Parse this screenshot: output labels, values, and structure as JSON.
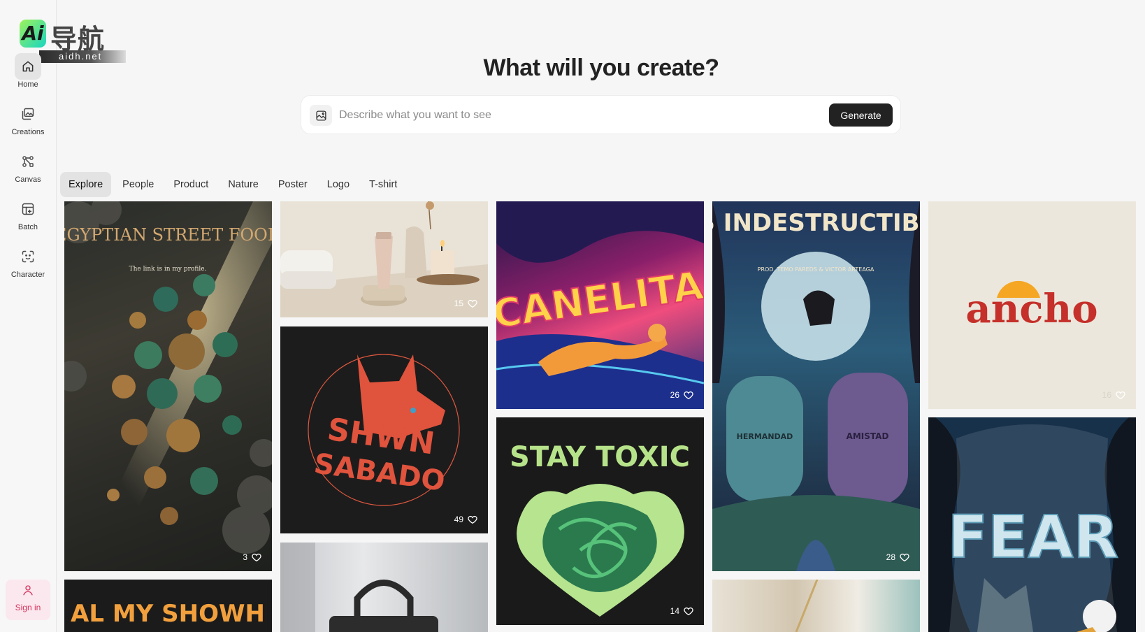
{
  "brand": {
    "logo_mark": "Ai",
    "logo_cn": "导航",
    "logo_domain": "aidh.net"
  },
  "sidebar": {
    "items": [
      {
        "label": "Home",
        "icon": "home-icon"
      },
      {
        "label": "Creations",
        "icon": "images-icon"
      },
      {
        "label": "Canvas",
        "icon": "canvas-nodes-icon"
      },
      {
        "label": "Batch",
        "icon": "batch-grid-icon"
      },
      {
        "label": "Character",
        "icon": "character-scan-icon"
      }
    ],
    "sign_in": "Sign in"
  },
  "header": {
    "headline": "What will you create?",
    "prompt_placeholder": "Describe what you want to see",
    "generate_label": "Generate"
  },
  "tabs": [
    "Explore",
    "People",
    "Product",
    "Nature",
    "Poster",
    "Logo",
    "T-shirt"
  ],
  "active_tab": "Explore",
  "gallery": [
    {
      "id": "egyptian",
      "title": "EGYPTIAN STREET FOOD",
      "subtitle": "The link is in my profile.",
      "likes": "3"
    },
    {
      "id": "skincare",
      "likes": "15"
    },
    {
      "id": "canelita",
      "title": "CANELITA",
      "likes": "26"
    },
    {
      "id": "indestructibles",
      "title": "LOS INDESTRUCTIBLES",
      "subtitle": "PROD. TEMO PAREDS & VICTOR ARTEAGA",
      "left_tomb": "HERMANDAD",
      "right_tomb": "AMISTAD",
      "likes": "28"
    },
    {
      "id": "ancho",
      "title": "ancho",
      "likes": "16"
    },
    {
      "id": "shwn",
      "title_1": "SHWN",
      "title_2": "SABADO",
      "likes": "49"
    },
    {
      "id": "staytoxic",
      "title": "STAY TOXIC",
      "likes": "14"
    },
    {
      "id": "fear",
      "title": "FEAR"
    },
    {
      "id": "showh",
      "title": "AL MY SHOWH"
    },
    {
      "id": "handbag"
    },
    {
      "id": "curtain"
    }
  ],
  "colors": {
    "accent_dark": "#222222",
    "signin_bg": "#fbe8ee",
    "signin_text": "#d6335f"
  }
}
